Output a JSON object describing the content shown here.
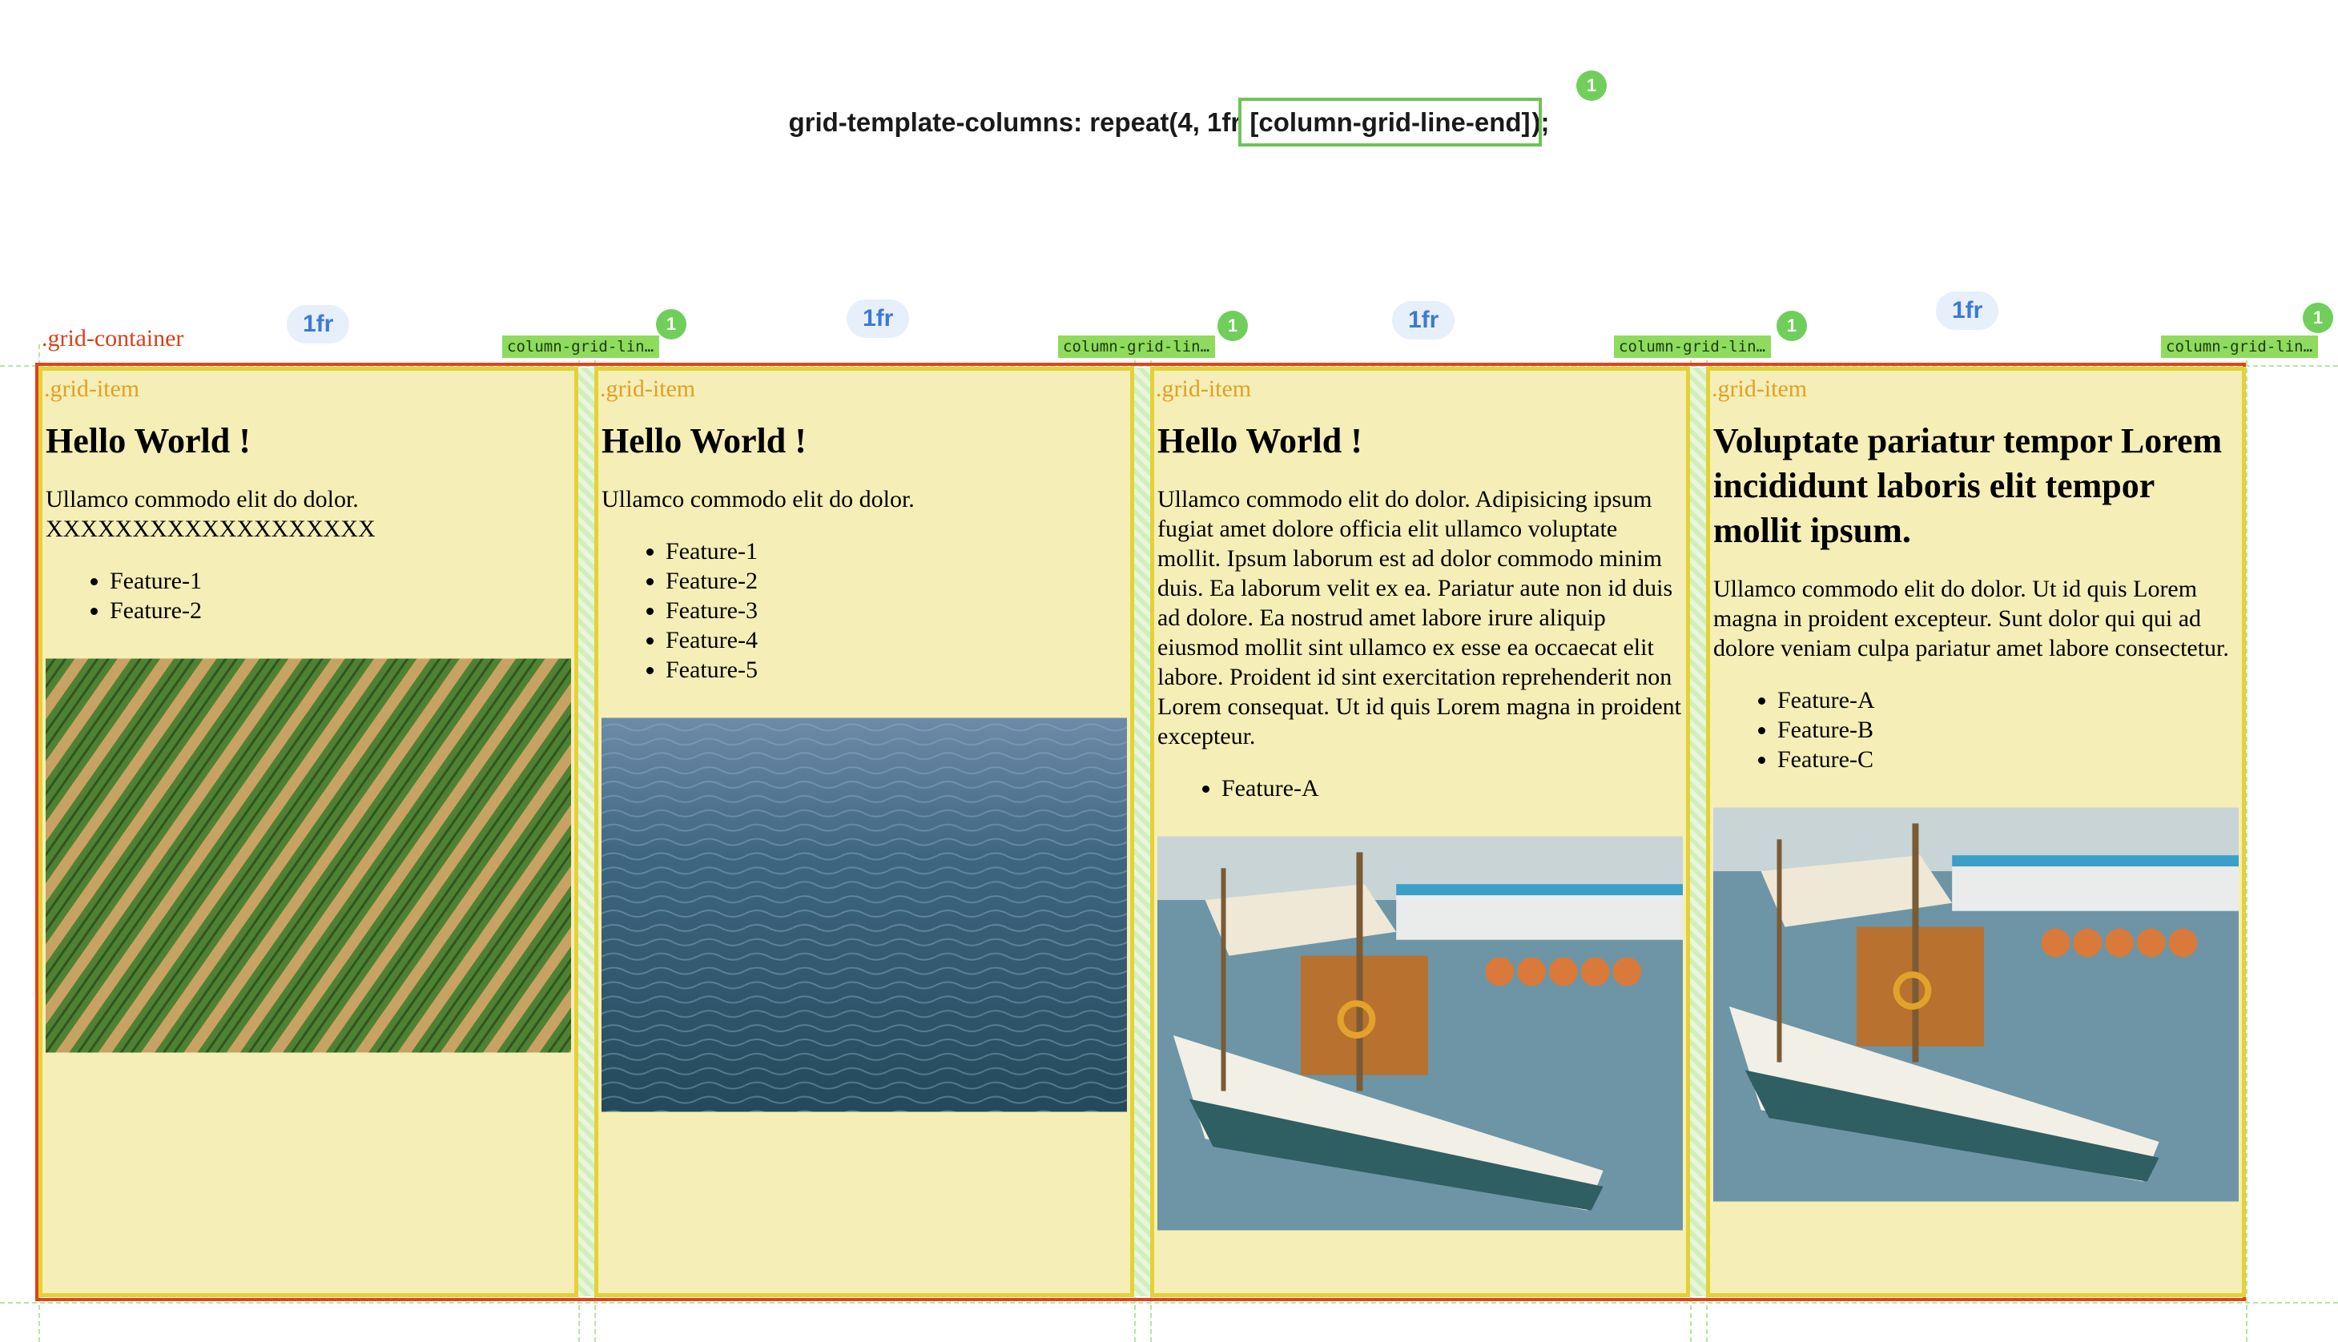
{
  "code_line": {
    "prefix": "grid-template-columns: repeat(4, 1fr ",
    "highlight": "[column-grid-line-end]",
    "suffix": ");"
  },
  "badge_count": "1",
  "track_size": "1fr",
  "line_tag": "column-grid-lin…",
  "container_label": ".grid-container",
  "colors": {
    "container_border": "#e0421c",
    "item_border": "#e3d235",
    "item_background": "#f5eeb6",
    "grid_line_overlay": "#8fdb5d",
    "track_pill": "#3b7ad6"
  },
  "items": [
    {
      "label": ".grid-item",
      "heading": "Hello World !",
      "text": "Ullamco commodo elit do dolor. XXXXXXXXXXXXXXXXXXX",
      "features": [
        "Feature-1",
        "Feature-2"
      ],
      "image": "field-rows-photo"
    },
    {
      "label": ".grid-item",
      "heading": "Hello World !",
      "text": "Ullamco commodo elit do dolor.",
      "features": [
        "Feature-1",
        "Feature-2",
        "Feature-3",
        "Feature-4",
        "Feature-5"
      ],
      "image": "ocean-water-photo"
    },
    {
      "label": ".grid-item",
      "heading": "Hello World !",
      "text": "Ullamco commodo elit do dolor. Adipisicing ipsum fugiat amet dolore officia elit ullamco voluptate mollit. Ipsum laborum est ad dolor commodo minim duis. Ea laborum velit ex ea. Pariatur aute non id duis ad dolore. Ea nostrud amet labore irure aliquip eiusmod mollit sint ullamco ex esse ea occaecat elit labore. Proident id sint exercitation reprehenderit non Lorem consequat. Ut id quis Lorem magna in proident excepteur.",
      "features": [
        "Feature-A"
      ],
      "image": "sailboat-harbor-photo"
    },
    {
      "label": ".grid-item",
      "heading": "Voluptate pariatur tempor Lorem incididunt laboris elit tempor mollit ipsum.",
      "text": "Ullamco commodo elit do dolor. Ut id quis Lorem magna in proident excepteur. Sunt dolor qui qui ad dolore veniam culpa pariatur amet labore consectetur.",
      "features": [
        "Feature-A",
        "Feature-B",
        "Feature-C"
      ],
      "image": "sailboat-harbor-photo"
    }
  ]
}
